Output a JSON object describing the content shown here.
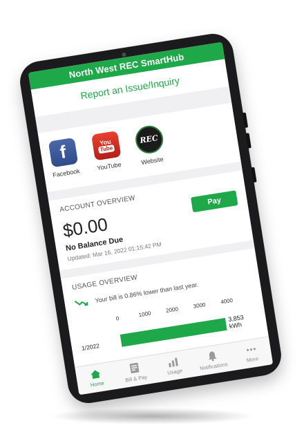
{
  "header": {
    "title": "North West REC SmartHub"
  },
  "report_link": "Report an Issue/Inquiry",
  "social": [
    {
      "label": "Facebook",
      "icon": "facebook-icon"
    },
    {
      "label": "YouTube",
      "icon": "youtube-icon",
      "logo_text": [
        "You",
        "Tube"
      ]
    },
    {
      "label": "Website",
      "icon": "rec-logo-icon",
      "logo_text": "REC"
    }
  ],
  "account": {
    "title": "ACCOUNT OVERVIEW",
    "amount": "$0.00",
    "pay_label": "Pay",
    "balance_label": "No Balance Due",
    "updated": "Updated: Mar 16, 2022 01:15:42 PM"
  },
  "usage": {
    "title": "USAGE OVERVIEW",
    "trend_text": "Your bill is 0.86% lower than last year.",
    "ticks": [
      "0",
      "1000",
      "2000",
      "3000",
      "4000"
    ],
    "bar_label": "1/2022",
    "bar_value": 3853,
    "bar_value_text": "3,853 kWh",
    "axis_max": 4000
  },
  "tabs": [
    {
      "label": "Home",
      "icon": "home-icon",
      "active": true
    },
    {
      "label": "Bill & Pay",
      "icon": "bill-icon",
      "active": false
    },
    {
      "label": "Usage",
      "icon": "usage-chart-icon",
      "active": false
    },
    {
      "label": "Notifications",
      "icon": "bell-icon",
      "active": false
    },
    {
      "label": "More",
      "icon": "more-dots-icon",
      "active": false
    }
  ],
  "colors": {
    "brand_green": "#1fa84a",
    "device_frame": "#1b1b1d"
  }
}
